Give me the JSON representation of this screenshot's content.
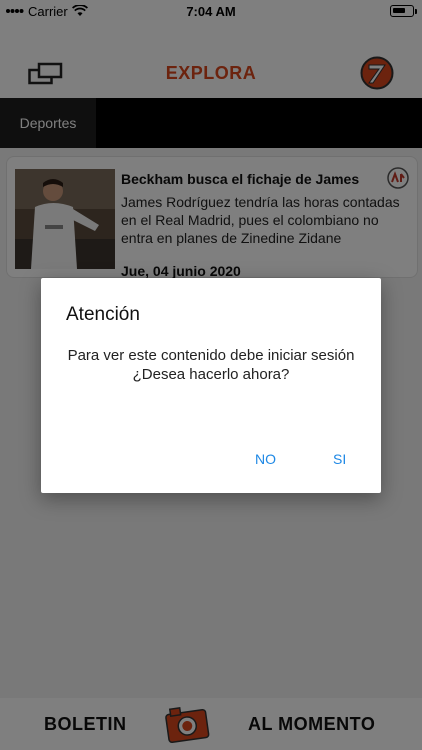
{
  "status_bar": {
    "carrier": "Carrier",
    "time": "7:04 AM"
  },
  "header": {
    "title": "EXPLORA",
    "left_icon": "windows-icon",
    "right_icon": "logo-icon"
  },
  "tabs": [
    {
      "label": "Deportes",
      "active": true
    }
  ],
  "article": {
    "headline": "Beckham busca el fichaje de James",
    "summary": "James Rodríguez tendría las horas contadas en el Real Madrid, pues el colombiano no entra en planes de Zinedine Zidane",
    "date": "Jue, 04 junio 2020"
  },
  "footer": {
    "left_label": "BOLETIN",
    "right_label": "AL MOMENTO",
    "center_icon": "camera-icon"
  },
  "dialog": {
    "title": "Atención",
    "message_line1": "Para ver este contenido debe iniciar sesión",
    "message_line2": "¿Desea hacerlo ahora?",
    "no_label": "NO",
    "yes_label": "SI"
  },
  "colors": {
    "brand": "#d8461c",
    "dialog_button": "#1e88e5",
    "tab_bar": "#000000"
  }
}
